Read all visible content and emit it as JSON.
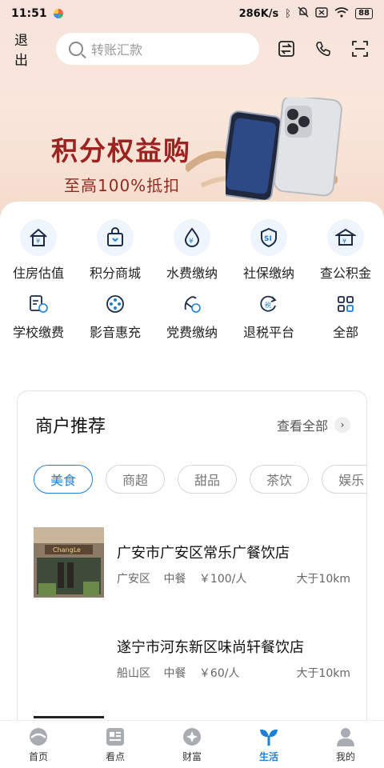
{
  "status_bar": {
    "time": "11:51",
    "network_speed": "286K/s",
    "battery": "88"
  },
  "header": {
    "logout_label": "退出",
    "search_placeholder": "转账汇款"
  },
  "banner": {
    "title": "积分权益购",
    "subtitle": "至高100%抵扣"
  },
  "services_row1": [
    {
      "label": "住房估值",
      "icon": "house-icon"
    },
    {
      "label": "积分商城",
      "icon": "shopping-bag-icon"
    },
    {
      "label": "水费缴纳",
      "icon": "water-drop-icon"
    },
    {
      "label": "社保缴纳",
      "icon": "social-security-icon"
    },
    {
      "label": "查公积金",
      "icon": "bank-building-icon"
    }
  ],
  "services_row2": [
    {
      "label": "学校缴费",
      "icon": "school-fee-icon"
    },
    {
      "label": "影音惠充",
      "icon": "film-reel-icon"
    },
    {
      "label": "党费缴纳",
      "icon": "party-fee-icon"
    },
    {
      "label": "退税平台",
      "icon": "tax-refund-icon"
    },
    {
      "label": "全部",
      "icon": "grid-all-icon"
    }
  ],
  "merchants": {
    "title": "商户推荐",
    "see_all": "查看全部",
    "chips": [
      "美食",
      "商超",
      "甜品",
      "茶饮",
      "娱乐"
    ],
    "stores": [
      {
        "name": "广安市广安区常乐广餐饮店",
        "district": "广安区",
        "cuisine": "中餐",
        "price": "￥100/人",
        "distance": "大于10km",
        "sign_text": "ChangLe"
      },
      {
        "name": "遂宁市河东新区味尚轩餐饮店",
        "district": "船山区",
        "cuisine": "中餐",
        "price": "￥60/人",
        "distance": "大于10km"
      }
    ]
  },
  "tabs": [
    {
      "label": "首页",
      "icon": "home-icon"
    },
    {
      "label": "看点",
      "icon": "news-icon"
    },
    {
      "label": "财富",
      "icon": "wealth-icon"
    },
    {
      "label": "生活",
      "icon": "life-sprout-icon"
    },
    {
      "label": "我的",
      "icon": "profile-icon"
    }
  ],
  "colors": {
    "accent": "#1e7fd6",
    "banner_text": "#9c2420"
  }
}
